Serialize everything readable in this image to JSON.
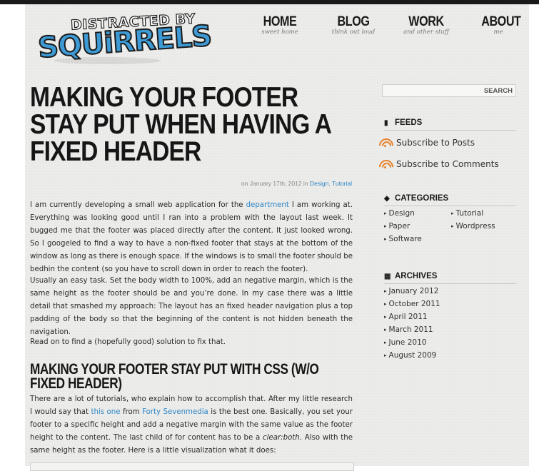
{
  "site": {
    "logo_top": "DISTRACTED BY",
    "logo_main": "SQUiRRELS"
  },
  "nav": [
    {
      "label": "HOME",
      "sub": "sweet home"
    },
    {
      "label": "BLOG",
      "sub": "think out loud"
    },
    {
      "label": "WORK",
      "sub": "and other stuff"
    },
    {
      "label": "ABOUT",
      "sub": "me"
    }
  ],
  "post": {
    "title": "MAKING YOUR FOOTER STAY PUT WHEN HAVING A FIXED HEADER",
    "meta_prefix": "on January 17th, 2012 in",
    "meta_cat1": "Design",
    "meta_sep": ", ",
    "meta_cat2": "Tutorial",
    "p1_a": "I am currently developing a small web application for the",
    "p1_link": "department",
    "p1_b": "I am working at. Everything was looking good until I ran into a problem with the layout last week. It bugged me that the footer was placed directly after the content. It just looked wrong. So I googeled to find a way to have a non-fixed footer that stays at the bottom of the window as long as there is enough space. If the windows is to small the footer should be bedhin the content (so you have to scroll down in order to reach the footer).",
    "p2": "Usually an easy task. Set the body width to 100%, add an negative margin, which is the same height as the footer should be and you’re done. In my case there was a little detail that smashed my approach: The layout has an fixed header navigation plus a top padding of the body so that the beginning of the content is not hidden beneath the navigation.",
    "p3": "Read on to find a (hopefully good) solution to fix that.",
    "subheading": "MAKING YOUR FOOTER STAY PUT WITH CSS (W/O FIXED HEADER)",
    "p4_a": "There are a lot of tutorials, who explain how to accomplish that. After my little research I would say that",
    "p4_link1": "this one",
    "p4_b": "from",
    "p4_link2": "Forty Sevenmedia",
    "p4_c": "is the best one. Basically, you set your footer to a specific height and add a negative margin with the same value as the footer height to the content. The last child of for content has to be a",
    "p4_em": "clear:both",
    "p4_d": ". Also with the same height as the footer. Here is a little visualization what it does:"
  },
  "sidebar": {
    "search_button": "SEARCH",
    "feeds_heading": "FEEDS",
    "feeds": [
      "Subscribe to Posts",
      "Subscribe to Comments"
    ],
    "categories_heading": "CATEGORIES",
    "categories_left": [
      "Design",
      "Paper",
      "Software"
    ],
    "categories_right": [
      "Tutorial",
      "Wordpress"
    ],
    "archives_heading": "ARCHIVES",
    "archives": [
      "January 2012",
      "October 2011",
      "April 2011",
      "March 2011",
      "June 2010",
      "August 2009"
    ]
  },
  "colors": {
    "link": "#2f87c7",
    "rss": "#e8812b",
    "logo_blue": "#3d9ad4"
  }
}
